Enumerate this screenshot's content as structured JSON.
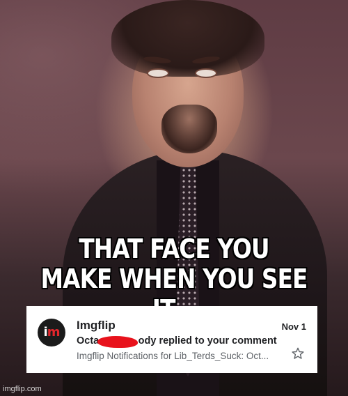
{
  "caption": {
    "line1": "THAT FACE YOU",
    "line2": "MAKE WHEN YOU SEE IT..."
  },
  "email": {
    "logo_i": "i",
    "logo_m": "m",
    "sender": "Imgflip",
    "date": "Nov 1",
    "subject": "Octa              ody replied to your comment",
    "snippet": "Imgflip Notifications for Lib_Terds_Suck: Oct...",
    "star_icon": "star-outline-icon"
  },
  "watermark": "imgflip.com",
  "colors": {
    "caption_text": "#ffffff",
    "caption_stroke": "#000000",
    "redaction": "#e8121c",
    "logo_accent": "#e3262c"
  }
}
